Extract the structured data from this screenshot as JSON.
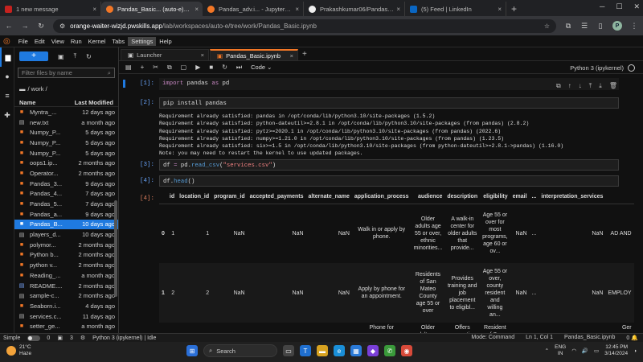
{
  "browser": {
    "tabs": [
      {
        "title": "1 new message",
        "color": "#c5221f",
        "active": false
      },
      {
        "title": "Pandas_Basic... (auto-e) - Jupyter",
        "color": "#f37726",
        "active": true
      },
      {
        "title": "Pandas_adv.i... - JupyterLab",
        "color": "#f37726",
        "active": false
      },
      {
        "title": "Prakashkumar06/Pandas_Basic...",
        "color": "#333333",
        "active": false
      },
      {
        "title": "(5) Feed | LinkedIn",
        "color": "#0a66c2",
        "active": false
      }
    ],
    "url_host": "orange-waiter-wizjd.pwskills.app",
    "url_path": "/lab/workspaces/auto-e/tree/work/Pandas_Basic.ipynb",
    "profile_initial": "P"
  },
  "menu": [
    "File",
    "Edit",
    "View",
    "Run",
    "Kernel",
    "Tabs",
    "Settings",
    "Help"
  ],
  "menu_selected": "Settings",
  "filebrowser": {
    "filter_placeholder": "Filter files by name",
    "breadcrumb": "/ work /",
    "col_name": "Name",
    "col_modified": "Last Modified",
    "files": [
      {
        "name": "Myntra_...",
        "modified": "12 days ago",
        "type": "notebook"
      },
      {
        "name": "new.txt",
        "modified": "a month ago",
        "type": "text"
      },
      {
        "name": "Numpy_P...",
        "modified": "5 days ago",
        "type": "notebook"
      },
      {
        "name": "Numpy_P...",
        "modified": "5 days ago",
        "type": "notebook"
      },
      {
        "name": "Numpy_P...",
        "modified": "5 days ago",
        "type": "notebook"
      },
      {
        "name": "oops1.ip...",
        "modified": "2 months ago",
        "type": "notebook"
      },
      {
        "name": "Operator...",
        "modified": "2 months ago",
        "type": "notebook"
      },
      {
        "name": "Pandas_3...",
        "modified": "9 days ago",
        "type": "notebook"
      },
      {
        "name": "Pandas_4...",
        "modified": "7 days ago",
        "type": "notebook"
      },
      {
        "name": "Pandas_5...",
        "modified": "7 days ago",
        "type": "notebook"
      },
      {
        "name": "Pandas_a...",
        "modified": "9 days ago",
        "type": "notebook"
      },
      {
        "name": "Pandas_B...",
        "modified": "10 days ago",
        "type": "notebook",
        "selected": true
      },
      {
        "name": "players_d...",
        "modified": "10 days ago",
        "type": "text"
      },
      {
        "name": "polymor...",
        "modified": "2 months ago",
        "type": "notebook"
      },
      {
        "name": "Python b...",
        "modified": "2 months ago",
        "type": "notebook"
      },
      {
        "name": "python v...",
        "modified": "2 months ago",
        "type": "notebook"
      },
      {
        "name": "Reading_...",
        "modified": "a month ago",
        "type": "notebook"
      },
      {
        "name": "README....",
        "modified": "2 months ago",
        "type": "markdown"
      },
      {
        "name": "sample-c...",
        "modified": "2 months ago",
        "type": "text"
      },
      {
        "name": "Seaborn.i...",
        "modified": "4 days ago",
        "type": "notebook"
      },
      {
        "name": "services.c...",
        "modified": "11 days ago",
        "type": "text"
      },
      {
        "name": "setter_ge...",
        "modified": "a month ago",
        "type": "notebook"
      }
    ]
  },
  "doctabs": [
    {
      "label": "Launcher",
      "active": false
    },
    {
      "label": "Pandas_Basic.ipynb",
      "active": true
    }
  ],
  "toolbar": {
    "cell_type": "Code",
    "kernel": "Python 3 (ipykernel)"
  },
  "cells": {
    "c1": {
      "prompt": "[1]:",
      "kw": "import",
      "mid": " pandas ",
      "kw2": "as",
      "end": " pd"
    },
    "c2": {
      "prompt": "[2]:",
      "code": "pip install pandas",
      "output": [
        "Requirement already satisfied: pandas in /opt/conda/lib/python3.10/site-packages (1.5.2)",
        "Requirement already satisfied: python-dateutil>=2.8.1 in /opt/conda/lib/python3.10/site-packages (from pandas) (2.8.2)",
        "Requirement already satisfied: pytz>=2020.1 in /opt/conda/lib/python3.10/site-packages (from pandas) (2022.6)",
        "Requirement already satisfied: numpy>=1.21.0 in /opt/conda/lib/python3.10/site-packages (from pandas) (1.23.5)",
        "Requirement already satisfied: six>=1.5 in /opt/conda/lib/python3.10/site-packages (from python-dateutil>=2.8.1->pandas) (1.16.0)",
        "Note: you may need to restart the kernel to use updated packages."
      ]
    },
    "c3": {
      "prompt": "[3]:",
      "pre": "df ",
      "op": "=",
      "mid": " pd.",
      "fn": "read_csv",
      "str": "\"services.csv\"",
      "end": ")"
    },
    "c4": {
      "prompt": "[4]:",
      "pre": "df.",
      "fn": "head",
      "end": "()",
      "out_prompt": "[4]:"
    }
  },
  "table": {
    "columns": [
      "",
      "id",
      "location_id",
      "program_id",
      "accepted_payments",
      "alternate_name",
      "application_process",
      "audience",
      "description",
      "eligibility",
      "email",
      "...",
      "interpretation_services",
      ""
    ],
    "rows": [
      [
        "0",
        "1",
        "1",
        "NaN",
        "NaN",
        "NaN",
        "Walk in or apply by phone.",
        "Older adults age 55 or over, ethnic minorities...",
        "A walk-in center for older adults that provide...",
        "Age 55 or over for most programs, age 60 or ov...",
        "NaN",
        "...",
        "NaN",
        "AD AND"
      ],
      [
        "1",
        "2",
        "2",
        "NaN",
        "NaN",
        "NaN",
        "Apply by phone for an appointment.",
        "Residents of San Mateo County age 55 or over",
        "Provides training and job placement to eligibl...",
        "Age 55 or over, county resident and willing an...",
        "NaN",
        "...",
        "NaN",
        "EMPLOY"
      ],
      [
        "",
        "",
        "",
        "",
        "",
        "",
        "Phone for",
        "Older adults age",
        "Offers supportive",
        "Resident of San Mateo",
        "",
        "",
        "",
        "Ger"
      ]
    ]
  },
  "statusbar": {
    "mode_label": "Simple",
    "count1": "0",
    "count2": "3",
    "kernel": "Python 3 (ipykernel) | Idle",
    "mode": "Mode: Command",
    "position": "Ln 1, Col 1",
    "file": "Pandas_Basic.ipynb",
    "bell": "0"
  },
  "taskbar": {
    "temp": "21°C",
    "condition": "Haze",
    "search": "Search",
    "lang1": "ENG",
    "lang2": "IN",
    "time": "12:45 PM",
    "date": "3/14/2024"
  }
}
